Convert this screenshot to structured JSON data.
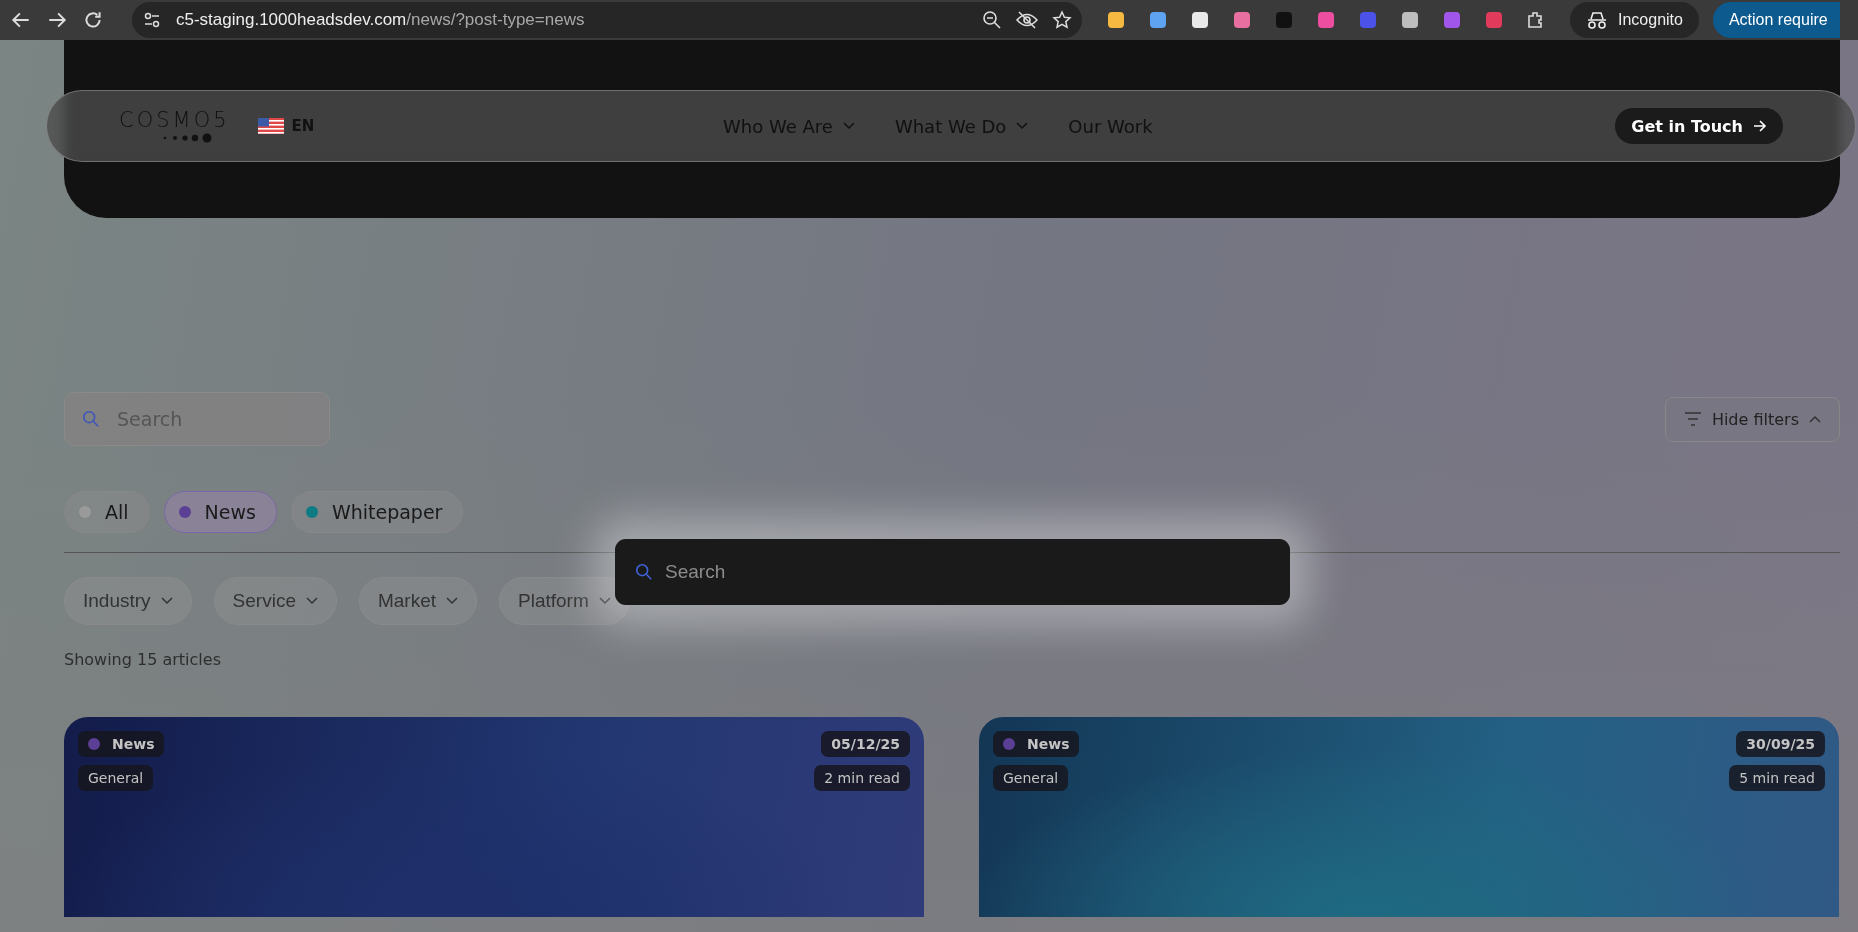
{
  "browser": {
    "url_host": "c5-staging.1000headsdev.com",
    "url_path": "/news/?post-type=news",
    "profile": "Incognito",
    "action_button": "Action require"
  },
  "nav": {
    "logo": "COSMO5",
    "language": "EN",
    "items": [
      {
        "label": "Who We Are",
        "has_menu": true
      },
      {
        "label": "What We Do",
        "has_menu": true
      },
      {
        "label": "Our Work",
        "has_menu": false
      }
    ],
    "cta": "Get in Touch"
  },
  "search": {
    "placeholder": "Search"
  },
  "hide_filters": "Hide filters",
  "types": [
    {
      "label": "All",
      "color": "#9a9a9a",
      "selected": false
    },
    {
      "label": "News",
      "color": "#5b3f95",
      "selected": true
    },
    {
      "label": "Whitepaper",
      "color": "#0e7c86",
      "selected": false
    }
  ],
  "dropdowns": [
    "Industry",
    "Service",
    "Market",
    "Platform"
  ],
  "count": "Showing 15 articles",
  "cards": [
    {
      "tag": {
        "label": "News",
        "color": "#5b3f95"
      },
      "category": "General",
      "date": "05/12/25",
      "read_time": "2 min read",
      "color": "#1e2f6a"
    },
    {
      "tag": {
        "label": "News",
        "color": "#5b3f95"
      },
      "category": "General",
      "date": "30/09/25",
      "read_time": "5 min read",
      "color": "#1f6a82"
    }
  ],
  "search_modal": {
    "placeholder": "Search"
  }
}
